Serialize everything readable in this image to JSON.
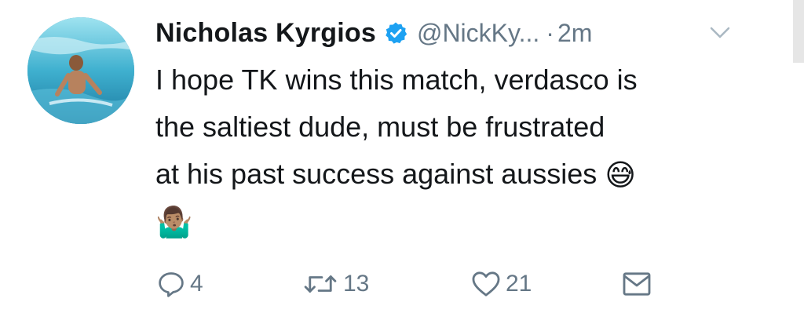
{
  "tweet": {
    "author_name": "Nicholas Kyrgios",
    "handle": "@NickKy...",
    "separator": "·",
    "time": "2m",
    "lines": [
      "I hope TK wins this match, verdasco is",
      "the saltiest dude, must be frustrated",
      "at his past success against aussies"
    ],
    "emoji_inline": "😅",
    "emoji_next_line": "🤷🏽‍♂️",
    "icons": {
      "verified": "verified-badge-icon",
      "caret": "chevron-down-icon",
      "reply": "reply-icon",
      "retweet": "retweet-icon",
      "like": "heart-icon",
      "dm": "envelope-icon"
    },
    "counts": {
      "replies": "4",
      "retweets": "13",
      "likes": "21"
    },
    "colors": {
      "verified_blue": "#1da1f2",
      "text": "#14171a",
      "muted": "#657786"
    }
  }
}
